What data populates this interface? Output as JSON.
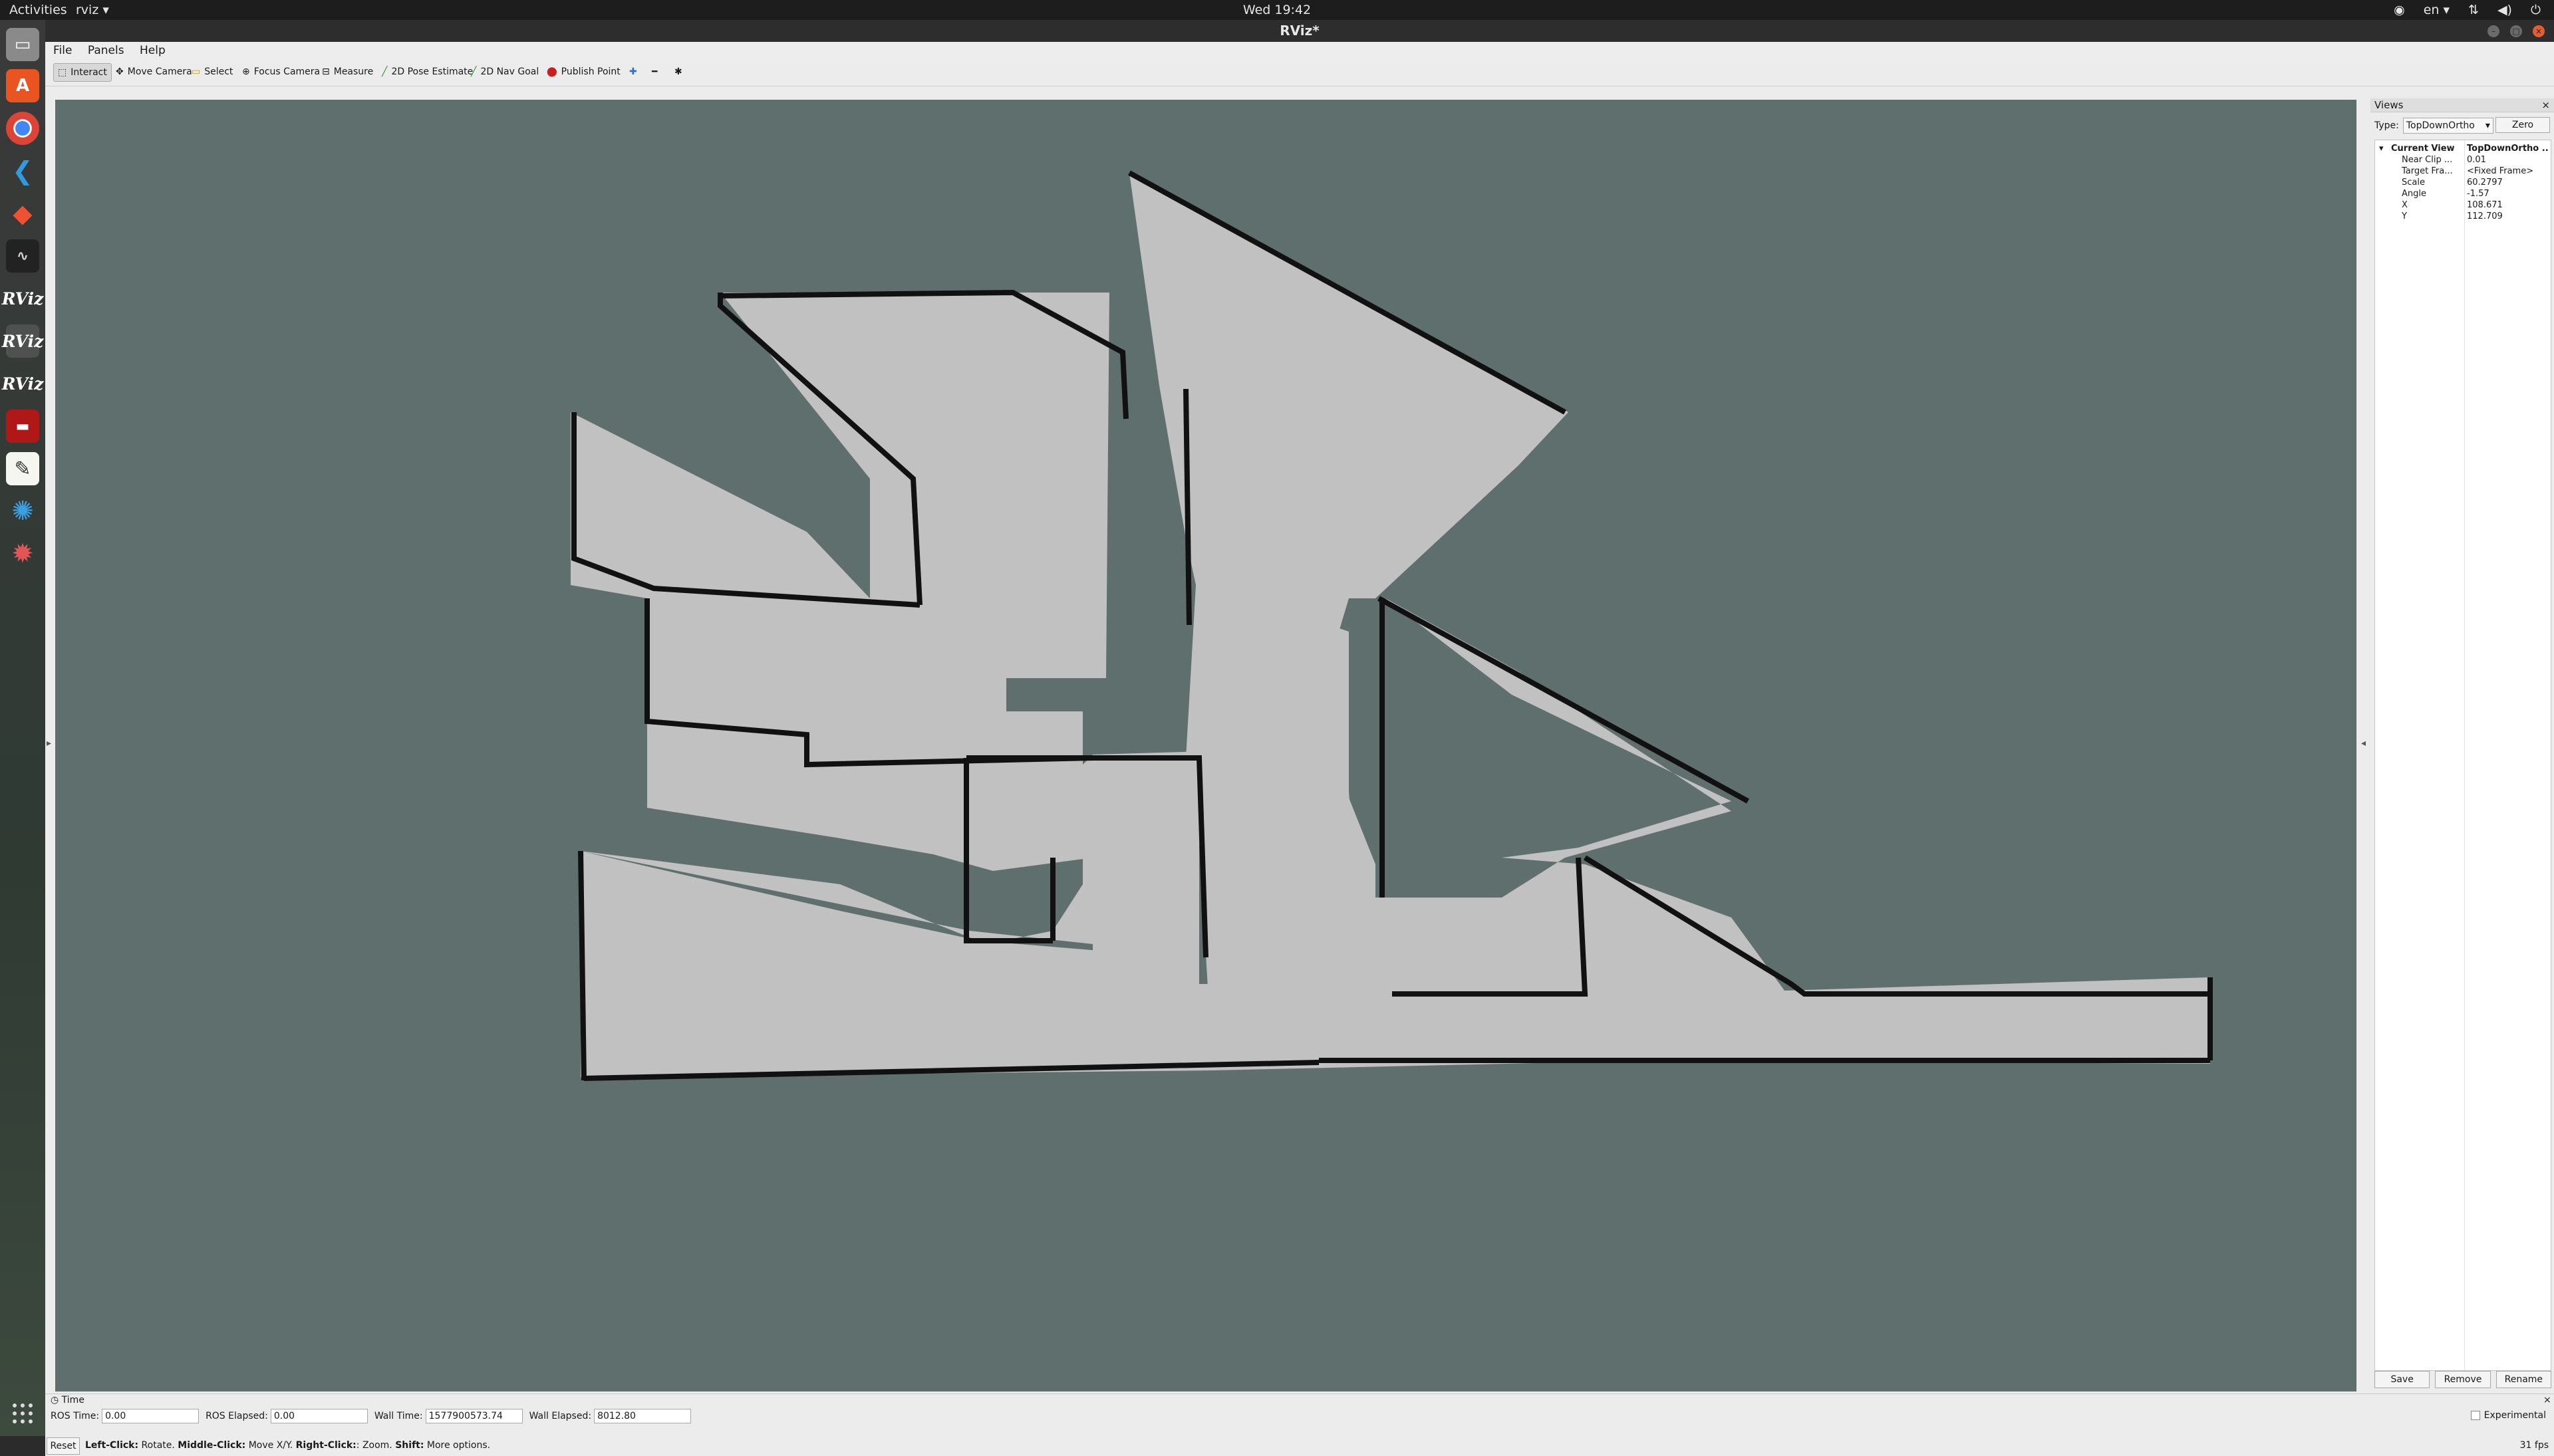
{
  "topbar": {
    "activities": "Activities",
    "app_menu": "rviz ▾",
    "clock": "Wed 19:42",
    "keyboard": "en ▾",
    "icons": [
      "accessibility-icon",
      "network-icon",
      "volume-icon",
      "power-icon"
    ]
  },
  "dock": {
    "tooltip": "rviz",
    "rviz_label": "RViz",
    "items": [
      "files-icon",
      "software-icon",
      "chrome-icon",
      "vscode-icon",
      "git-icon",
      "system-monitor-icon",
      "rviz-icon",
      "rviz-icon",
      "rviz-icon",
      "terminal-icon",
      "text-editor-icon",
      "spider-icon",
      "network-web-icon"
    ]
  },
  "window": {
    "title": "RViz*",
    "menu": [
      "File",
      "Panels",
      "Help"
    ]
  },
  "toolbar": {
    "tools": [
      "Interact",
      "Move Camera",
      "Select",
      "Focus Camera",
      "Measure",
      "2D Pose Estimate",
      "2D Nav Goal",
      "Publish Point"
    ],
    "active": "Interact"
  },
  "views_panel": {
    "title": "Views",
    "type_label": "Type:",
    "type_value": "TopDownOrtho",
    "zero_button": "Zero",
    "current_view_label": "Current View",
    "current_view_value": "TopDownOrtho ...",
    "properties": [
      {
        "key": "Near Clip ...",
        "value": "0.01"
      },
      {
        "key": "Target Fra...",
        "value": "<Fixed Frame>"
      },
      {
        "key": "Scale",
        "value": "60.2797"
      },
      {
        "key": "Angle",
        "value": "-1.57"
      },
      {
        "key": "X",
        "value": "108.671"
      },
      {
        "key": "Y",
        "value": "112.709"
      }
    ],
    "buttons": [
      "Save",
      "Remove",
      "Rename"
    ]
  },
  "time_panel": {
    "title": "Time",
    "ros_time_label": "ROS Time:",
    "ros_time_value": "0.00",
    "ros_elapsed_label": "ROS Elapsed:",
    "ros_elapsed_value": "0.00",
    "wall_time_label": "Wall Time:",
    "wall_time_value": "1577900573.74",
    "wall_elapsed_label": "Wall Elapsed:",
    "wall_elapsed_value": "8012.80",
    "experimental_label": "Experimental"
  },
  "statusbar": {
    "reset": "Reset",
    "hint_left_click": "Left-Click:",
    "hint_left_action": " Rotate. ",
    "hint_middle_click": "Middle-Click:",
    "hint_middle_action": " Move X/Y. ",
    "hint_right_click": "Right-Click:",
    "hint_right_action": ": Zoom. ",
    "hint_shift": "Shift:",
    "hint_shift_action": " More options.",
    "fps": "31 fps"
  },
  "colors": {
    "map_background": "#5f6f6d",
    "map_free": "#c1c1c1",
    "map_wall": "#111111"
  }
}
